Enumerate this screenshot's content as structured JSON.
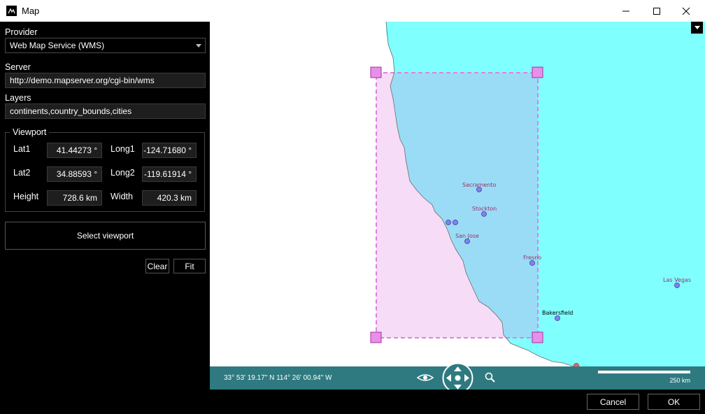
{
  "window": {
    "title": "Map",
    "minimize_icon": "minimize-icon",
    "maximize_icon": "maximize-icon",
    "close_icon": "close-icon"
  },
  "sidebar": {
    "provider_label": "Provider",
    "provider_value": "Web Map Service (WMS)",
    "server_label": "Server",
    "server_value": "http://demo.mapserver.org/cgi-bin/wms",
    "layers_label": "Layers",
    "layers_value": "continents,country_bounds,cities",
    "viewport": {
      "legend": "Viewport",
      "lat1_label": "Lat1",
      "lat1_value": "41.44273 °",
      "long1_label": "Long1",
      "long1_value": "-124.71680 °",
      "lat2_label": "Lat2",
      "lat2_value": "34.88593 °",
      "long2_label": "Long2",
      "long2_value": "-119.61914 °",
      "height_label": "Height",
      "height_value": "728.6 km",
      "width_label": "Width",
      "width_value": "420.3 km"
    },
    "select_viewport_label": "Select viewport",
    "clear_label": "Clear",
    "fit_label": "Fit"
  },
  "map": {
    "cities": [
      "Sacramento",
      "Stockton",
      "San Jose",
      "Fresno",
      "Las Vegas",
      "Bakersfield"
    ],
    "land_color": "#ffffff",
    "water_color": "#80ffff",
    "selection_color": "#e080e0",
    "city_marker_color": "#8080ff"
  },
  "statusbar": {
    "coordinates": "33° 53' 19.17\" N 114° 26' 00.94\" W",
    "scale_label": "250 km",
    "eye_icon": "eye-icon",
    "pan_icon": "pan-navigation-icon",
    "zoom_icon": "magnifier-icon"
  },
  "dialog": {
    "cancel_label": "Cancel",
    "ok_label": "OK"
  }
}
